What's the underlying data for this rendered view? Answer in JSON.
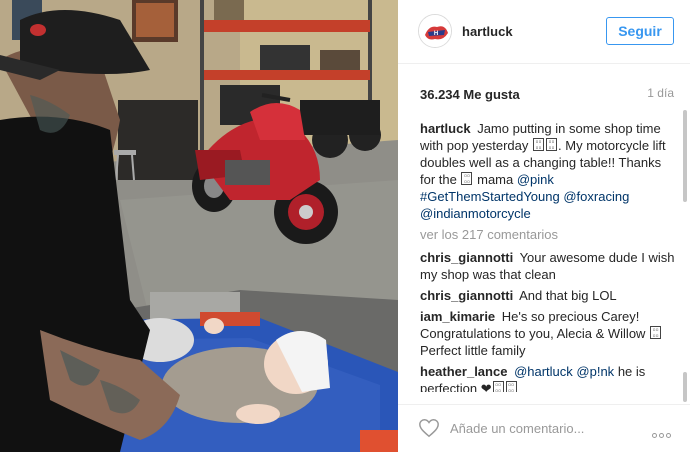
{
  "post": {
    "username": "hartluck",
    "follow_label": "Seguir",
    "likes": "36.234 Me gusta",
    "time": "1 día",
    "caption": {
      "user": "hartluck",
      "part1": "Jamo putting in some shop time with pop yesterday",
      "part2": ". My motorcycle lift doubles well as a changing table!! Thanks for the",
      "part3": "mama",
      "tag1": "@pink",
      "tag2": "#GetThemStartedYoung",
      "tag3": "@foxracing",
      "tag4": "@indianmotorcycle"
    },
    "view_all": "ver los 217 comentarios",
    "comments": [
      {
        "user": "chris_giannotti",
        "text": "Your awesome dude I wish my shop was that clean"
      },
      {
        "user": "chris_giannotti",
        "text": "And that big LOL"
      },
      {
        "user": "iam_kimarie",
        "text": "He's so precious Carey! Congratulations to you, Alecia & Willow",
        "text2": "Perfect little family"
      },
      {
        "user": "heather_lance",
        "tag1": "@hartluck",
        "tag2": "@p!nk",
        "text": "he is perfection"
      }
    ],
    "comment_placeholder": "Añade un comentario...",
    "icons": {
      "heart": "heart-icon",
      "more": "more-options-icon",
      "avatar": "avatar-logo",
      "emoji": "missing-emoji-glyph"
    },
    "colors": {
      "accent": "#3897f0",
      "link": "#003569",
      "muted": "#999999"
    }
  }
}
